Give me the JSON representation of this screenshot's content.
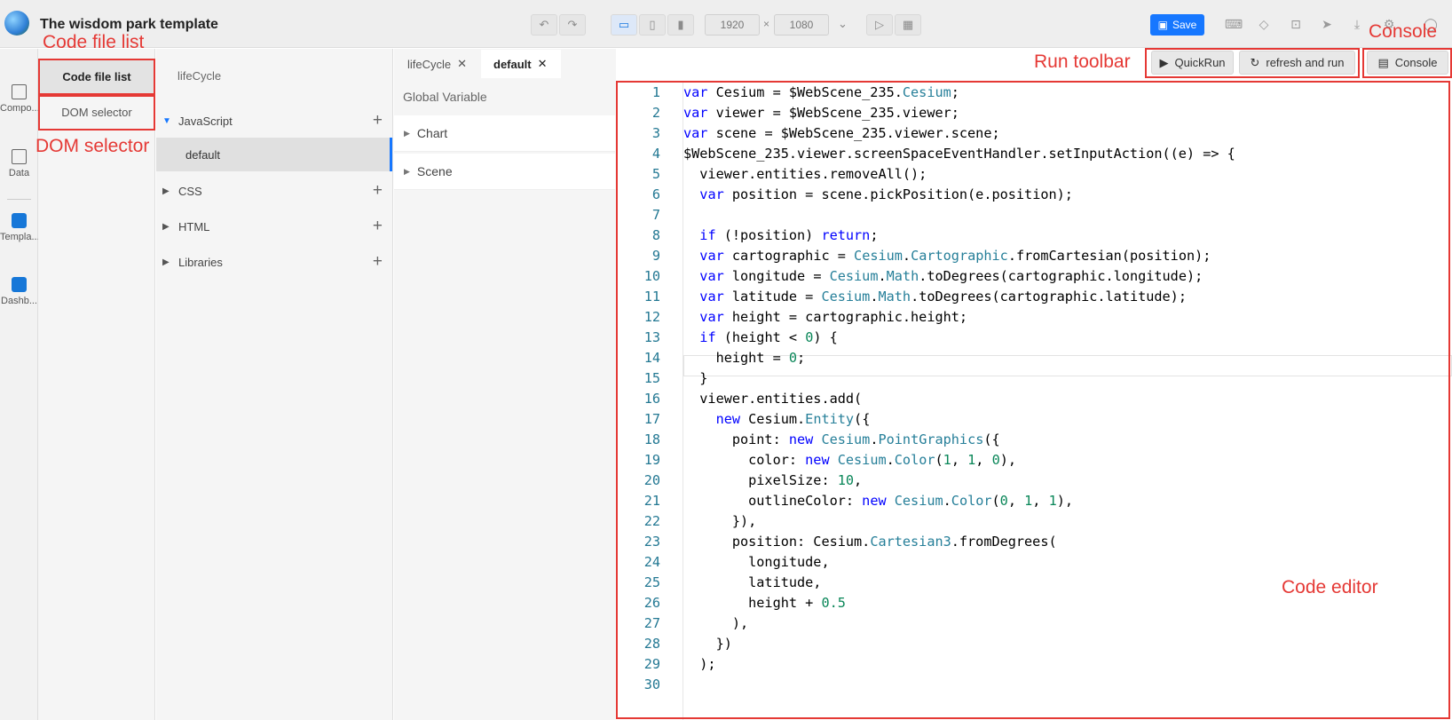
{
  "app": {
    "title": "The wisdom park template"
  },
  "toolbar": {
    "width_value": "1920",
    "height_value": "1080",
    "times": "×",
    "save_label": "Save"
  },
  "rail": {
    "items": [
      {
        "label": "Compo...",
        "icon": "components-icon"
      },
      {
        "label": "Data",
        "icon": "data-icon"
      },
      {
        "label": "Templa...",
        "icon": "template-icon"
      },
      {
        "label": "Dashb...",
        "icon": "dashboard-icon"
      }
    ]
  },
  "panels": {
    "code_file_list": "Code file list",
    "dom_selector": "DOM selector"
  },
  "tree": {
    "lifecycle": "lifeCycle",
    "javascript": "JavaScript",
    "default": "default",
    "css": "CSS",
    "html": "HTML",
    "libraries": "Libraries"
  },
  "doc_tabs": [
    {
      "label": "lifeCycle"
    },
    {
      "label": "default"
    }
  ],
  "variables": {
    "heading": "Global Variable",
    "items": [
      "Chart",
      "Scene"
    ]
  },
  "run_toolbar": {
    "quickrun": "QuickRun",
    "refresh": "refresh and run",
    "console": "Console"
  },
  "editor": {
    "lines": [
      "var Cesium = $WebScene_235.Cesium;",
      "var viewer = $WebScene_235.viewer;",
      "var scene = $WebScene_235.viewer.scene;",
      "$WebScene_235.viewer.screenSpaceEventHandler.setInputAction((e) => {",
      "  viewer.entities.removeAll();",
      "  var position = scene.pickPosition(e.position);",
      "",
      "  if (!position) return;",
      "  var cartographic = Cesium.Cartographic.fromCartesian(position);",
      "  var longitude = Cesium.Math.toDegrees(cartographic.longitude);",
      "  var latitude = Cesium.Math.toDegrees(cartographic.latitude);",
      "  var height = cartographic.height;",
      "  if (height < 0) {",
      "    height = 0;",
      "  }",
      "  viewer.entities.add(",
      "    new Cesium.Entity({",
      "      point: new Cesium.PointGraphics({",
      "        color: new Cesium.Color(1, 1, 0),",
      "        pixelSize: 10,",
      "        outlineColor: new Cesium.Color(0, 1, 1),",
      "      }),",
      "      position: Cesium.Cartesian3.fromDegrees(",
      "        longitude,",
      "        latitude,",
      "        height + 0.5",
      "      ),",
      "    })",
      "  );",
      ""
    ]
  },
  "annotations": {
    "code_file_list": "Code file list",
    "dom_selector": "DOM selector",
    "run_toolbar": "Run toolbar",
    "console": "Console",
    "code_editor": "Code editor"
  },
  "colors": {
    "accent": "#1677ff",
    "annotation": "#e53935",
    "keyword": "#0000ff",
    "type": "#267f99",
    "number": "#098658",
    "line_number": "#237893"
  }
}
